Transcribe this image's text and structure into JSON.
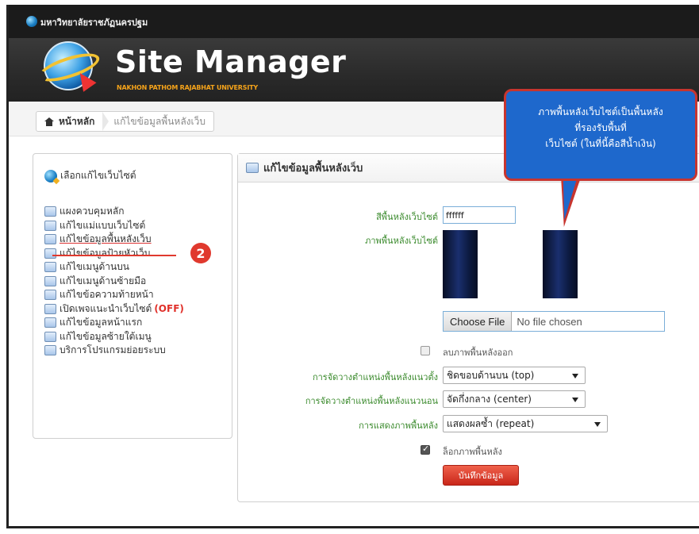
{
  "topbar": {
    "university_name": "มหาวิทยาลัยราชภัฏนครปฐม"
  },
  "header": {
    "brand_title": "Site Manager",
    "brand_subtitle": "NAKHON PATHOM RAJABHAT UNIVERSITY"
  },
  "breadcrumb": {
    "home_label": "หน้าหลัก",
    "current_label": "แก้ไขข้อมูลพื้นหลังเว็บ"
  },
  "sidebar": {
    "header": "เลือกแก้ไขเว็บไซต์",
    "items": [
      {
        "label": "แผงควบคุมหลัก"
      },
      {
        "label": "แก้ไขแม่แบบเว็บไซต์"
      },
      {
        "label": "แก้ไขข้อมูลพื้นหลังเว็บ"
      },
      {
        "label": "แก้ไขข้อมูลป้ายหัวเว็บ"
      },
      {
        "label": "แก้ไขเมนูด้านบน"
      },
      {
        "label": "แก้ไขเมนูด้านซ้ายมือ"
      },
      {
        "label": "แก้ไขข้อความท้ายหน้า"
      },
      {
        "label": "เปิดเพจแนะนำเว็บไซต์",
        "badge": "(OFF)"
      },
      {
        "label": "แก้ไขข้อมูลหน้าแรก"
      },
      {
        "label": "แก้ไขข้อมูลซ้ายใต้เมนู"
      },
      {
        "label": "บริการโปรแกรมย่อยระบบ"
      }
    ],
    "step_badge": "2"
  },
  "panel": {
    "title": "แก้ไขข้อมูลพื้นหลังเว็บ",
    "bg_color_label": "สีพื้นหลังเว็บไซต์",
    "bg_color_value": "ffffff",
    "bg_image_label": "ภาพพื้นหลังเว็บไซต์",
    "choose_file_label": "Choose File",
    "file_status": "No file chosen",
    "remove_image_label": "ลบภาพพื้นหลังออก",
    "vertical_pos_label": "การจัดวางตำแหน่งพื้นหลังแนวตั้ง",
    "vertical_pos_value": "ชิดขอบด้านบน (top)",
    "horizontal_pos_label": "การจัดวางตำแหน่งพื้นหลังแนวนอน",
    "horizontal_pos_value": "จัดกึ่งกลาง (center)",
    "display_label": "การแสดงภาพพื้นหลัง",
    "display_value": "แสดงผลซ้ำ (repeat)",
    "lock_label": "ล็อกภาพพื้นหลัง",
    "save_label": "บันทึกข้อมูล"
  },
  "callout": {
    "line1": "ภาพพื้นหลังเว็บไซต์เป็นพื้นหลัง",
    "line2": "ที่รองรับพื้นที่",
    "line3": "เว็บไซต์ (ในที่นี้คือสีน้ำเงิน)"
  }
}
